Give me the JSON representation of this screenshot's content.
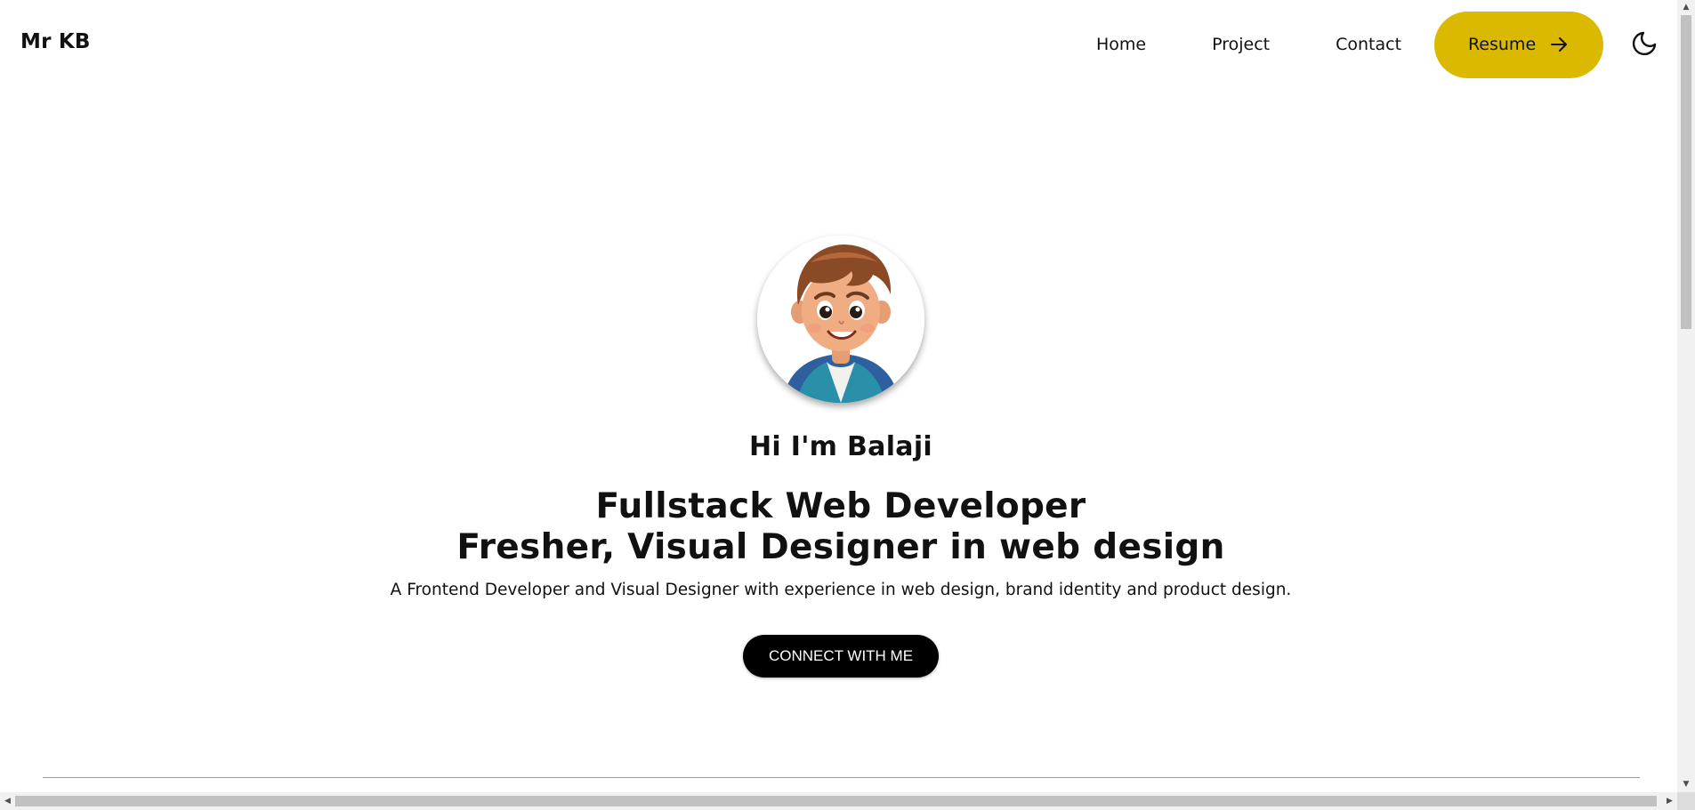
{
  "header": {
    "brand": "Mr KB",
    "nav": [
      {
        "label": "Home"
      },
      {
        "label": "Project"
      },
      {
        "label": "Contact"
      }
    ],
    "resume_label": "Resume",
    "resume_icon": "arrow-right-icon",
    "theme_icon": "moon-icon"
  },
  "hero": {
    "greeting": "Hi I'm Balaji",
    "title_line1": "Fullstack Web Developer",
    "title_line2": "Fresher, Visual Designer in web design",
    "description": "A Frontend Developer and Visual Designer with experience in web design, brand identity and product design.",
    "cta_label": "CONNECT WITH ME",
    "avatar_icon": "cartoon-boy-avatar"
  },
  "colors": {
    "accent": "#dbb900",
    "cta_bg": "#000000",
    "text": "#111111"
  }
}
